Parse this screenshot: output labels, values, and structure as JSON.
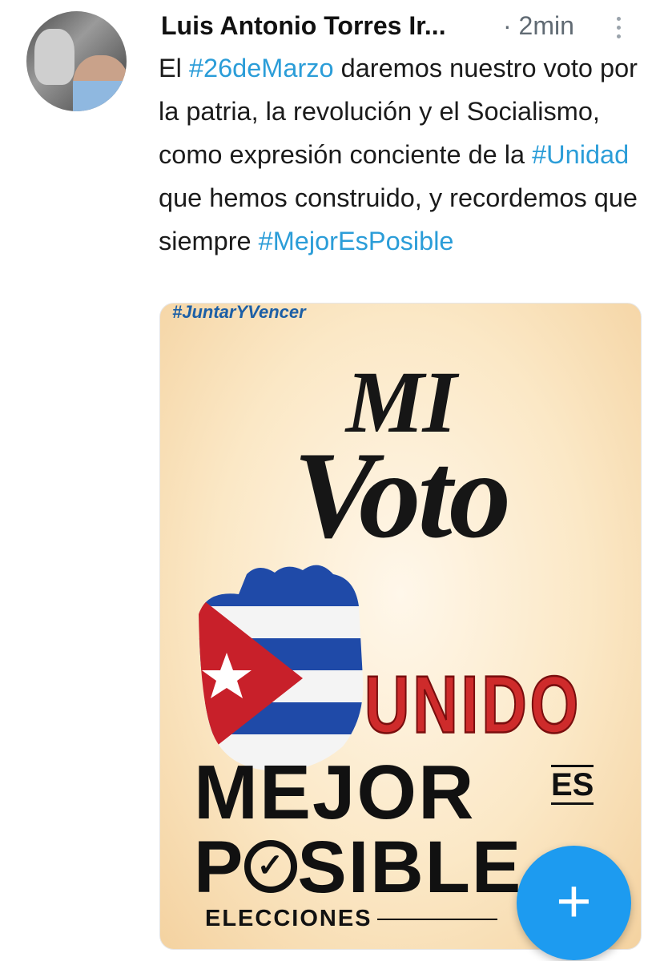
{
  "tweet": {
    "author": "Luis Antonio Torres Ir...",
    "time": "· 2min",
    "text_parts": [
      {
        "text": "El ",
        "hashtag": false
      },
      {
        "text": "#26deMarzo",
        "hashtag": true
      },
      {
        "text": " daremos nuestro voto por la patria, la revolución y el Socialismo,  como expresión conciente de la ",
        "hashtag": false
      },
      {
        "text": "#Unidad",
        "hashtag": true
      },
      {
        "text": " que hemos construido, y recordemos que siempre ",
        "hashtag": false
      },
      {
        "text": "#MejorEsPosible",
        "hashtag": true
      }
    ]
  },
  "media": {
    "top_tag": "#JuntarYVencer",
    "line_mi": "MI",
    "line_voto": "Voto",
    "unido": "UNIDO",
    "mejor": "MEJOR",
    "es": "ES",
    "posible_p": "P",
    "posible_check": "✓",
    "posible_rest": "SIBLE",
    "elecciones": "ELECCIONES"
  },
  "fab": {
    "icon": "plus-icon",
    "label": "+"
  },
  "colors": {
    "hashtag": "#2b9dd8",
    "fab": "#1d9bf0",
    "unido": "#ce2b2b"
  }
}
